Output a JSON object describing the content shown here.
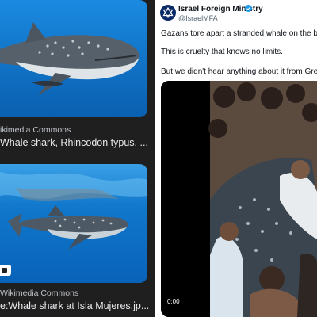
{
  "results": [
    {
      "source": "ikimedia Commons",
      "title": "Whale shark, Rhincodon typus, ..."
    },
    {
      "source": "Wikimedia Commons",
      "title": "e:Whale shark at Isla Mujeres.jp..."
    }
  ],
  "tweet": {
    "account_name": "Israel Foreign Ministry",
    "handle": "@IsraelMFA",
    "lines": [
      "Gazans tore apart a stranded whale on the beach.",
      "This is cruelty that knows no limits.",
      "But we didn't hear anything about it from Greta PR"
    ],
    "video_time": "0:00"
  },
  "colors": {
    "verified": "#1d9bf0",
    "ocean_blue": "#0a6fc2",
    "avatar": "#0a2a66"
  },
  "icons": [
    "verified-badge-icon",
    "image-badge-icon",
    "star-of-david-icon"
  ]
}
